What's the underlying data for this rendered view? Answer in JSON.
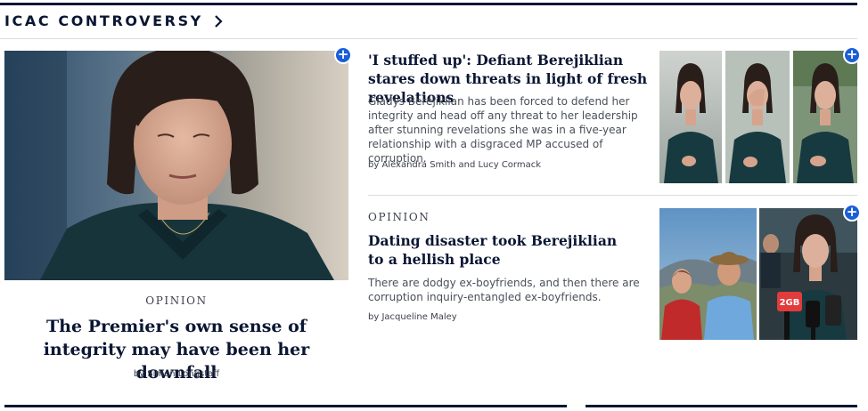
{
  "section": {
    "title": "ICAC CONTROVERSY",
    "arrow_icon": "chevron-right-icon"
  },
  "lead": {
    "kicker": "OPINION",
    "headline": "The Premier's own sense of integrity may have been her downfall",
    "byline": "by Simon Longstaff",
    "save_icon": "plus-icon"
  },
  "story1": {
    "headline": "'I stuffed up': Defiant Berejiklian stares down threats in light of fresh revelations",
    "summary": "Gladys Berejiklian has been forced to defend her integrity and head off any threat to her leadership after stunning revelations she was in a five-year relationship with a disgraced MP accused of corruption.",
    "byline": "by Alexandra Smith and Lucy Cormack",
    "save_icon": "plus-icon"
  },
  "story2": {
    "kicker": "OPINION",
    "headline": "Dating disaster took Berejiklian to a hellish place",
    "summary": "There are dodgy ex-boyfriends, and then there are corruption inquiry-entangled ex-boyfriends.",
    "byline": "by Jacqueline Maley",
    "save_icon": "plus-icon",
    "microphone_text": "2GB"
  },
  "colors": {
    "navy": "#0a1633",
    "accent": "#1a5ed8",
    "rule": "#dcdcdc"
  }
}
